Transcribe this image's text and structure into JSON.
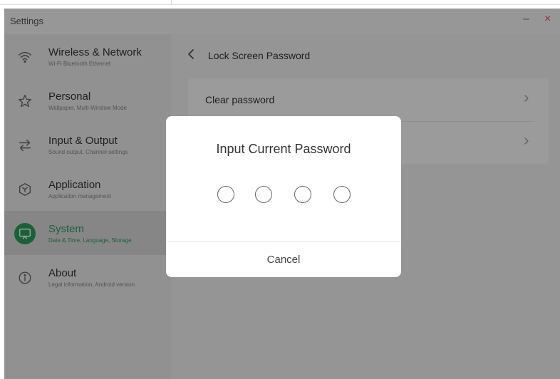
{
  "window": {
    "title": "Settings",
    "minimize_glyph": "–",
    "close_glyph": "×"
  },
  "sidebar": {
    "items": [
      {
        "label": "Wireless & Network",
        "subtitle": "Wi-Fi Bluetooth Ethernet",
        "icon": "wifi-icon",
        "active": false
      },
      {
        "label": "Personal",
        "subtitle": "Wallpaper, Multi-Window Mode",
        "icon": "star-icon",
        "active": false
      },
      {
        "label": "Input & Output",
        "subtitle": "Sound output, Channel settings",
        "icon": "swap-arrows-icon",
        "active": false
      },
      {
        "label": "Application",
        "subtitle": "Application management",
        "icon": "cube-icon",
        "active": false
      },
      {
        "label": "System",
        "subtitle": "Date & Time, Language, Storage",
        "icon": "monitor-icon",
        "active": true
      },
      {
        "label": "About",
        "subtitle": "Legal information, Android version",
        "icon": "info-icon",
        "active": false
      }
    ]
  },
  "main": {
    "title": "Lock Screen Password",
    "rows": [
      {
        "label": "Clear password"
      },
      {
        "label": ""
      }
    ]
  },
  "dialog": {
    "title": "Input Current Password",
    "pin_length": 4,
    "cancel_label": "Cancel"
  },
  "colors": {
    "accent": "#2b9d5b",
    "close": "#e05050"
  }
}
